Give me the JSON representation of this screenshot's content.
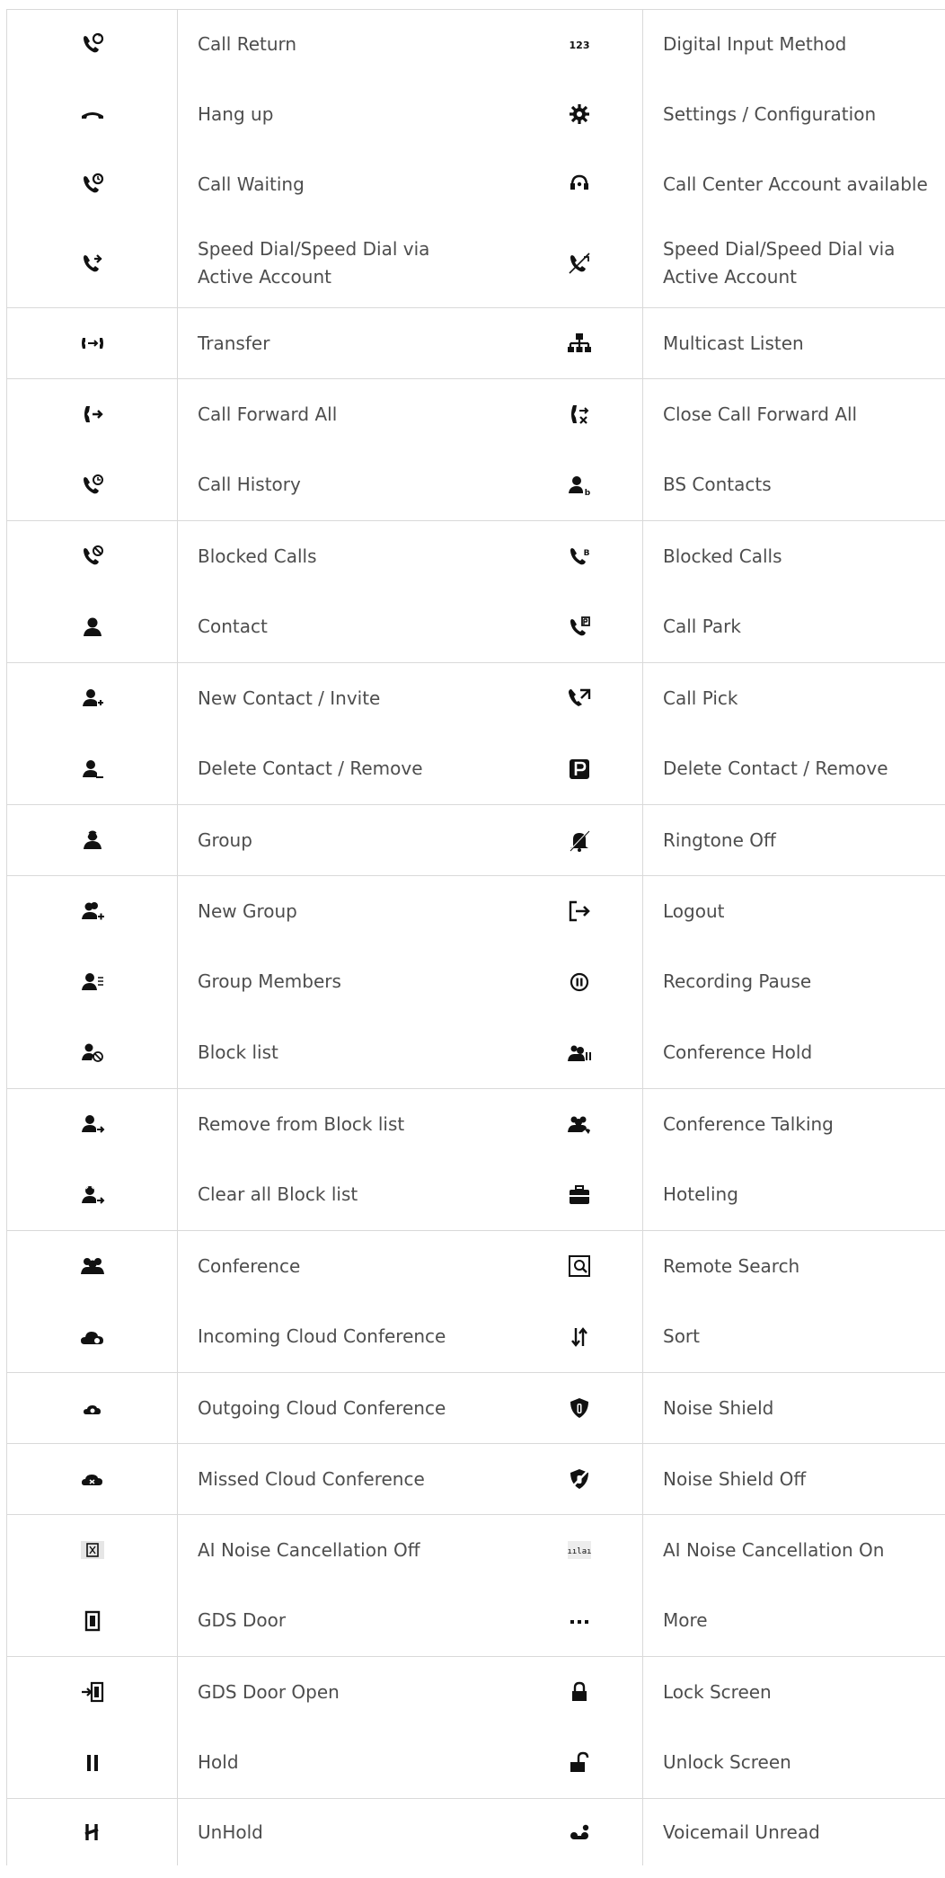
{
  "rows": [
    {
      "left_icon": "call-return-icon",
      "left_label": "Call Return",
      "right_icon": "digital-input-icon",
      "right_label": "Digital Input Method",
      "sep_after": false
    },
    {
      "left_icon": "hang-up-icon",
      "left_label": "Hang up",
      "right_icon": "settings-icon",
      "right_label": "Settings / Configuration",
      "sep_after": false
    },
    {
      "left_icon": "call-waiting-icon",
      "left_label": "Call Waiting",
      "right_icon": "call-center-icon",
      "right_label": "Call Center Account available",
      "sep_after": false
    },
    {
      "left_icon": "speed-dial-icon",
      "left_label": "Speed Dial/Speed Dial via\nActive Account",
      "right_icon": "speed-dial-alt-icon",
      "right_label": "Speed Dial/Speed Dial via\nActive Account",
      "sep_after": true
    },
    {
      "left_icon": "transfer-icon",
      "left_label": "Transfer",
      "right_icon": "multicast-listen-icon",
      "right_label": "Multicast Listen",
      "sep_after": true
    },
    {
      "left_icon": "call-forward-all-icon",
      "left_label": "Call Forward All",
      "right_icon": "close-call-forward-icon",
      "right_label": "Close Call Forward All",
      "sep_after": false
    },
    {
      "left_icon": "call-history-icon",
      "left_label": "Call History",
      "right_icon": "bs-contacts-icon",
      "right_label": "BS Contacts",
      "sep_after": true
    },
    {
      "left_icon": "blocked-calls-icon",
      "left_label": "Blocked Calls",
      "right_icon": "blocked-calls-alt-icon",
      "right_label": "Blocked Calls",
      "sep_after": false
    },
    {
      "left_icon": "contact-icon",
      "left_label": "Contact",
      "right_icon": "call-park-icon",
      "right_label": "Call Park",
      "sep_after": true
    },
    {
      "left_icon": "new-contact-icon",
      "left_label": "New Contact / Invite",
      "right_icon": "call-pick-icon",
      "right_label": "Call Pick",
      "sep_after": false
    },
    {
      "left_icon": "delete-contact-icon",
      "left_label": "Delete Contact / Remove",
      "right_icon": "delete-contact-p-icon",
      "right_label": "Delete Contact / Remove",
      "sep_after": true
    },
    {
      "left_icon": "group-icon",
      "left_label": "Group",
      "right_icon": "ringtone-off-icon",
      "right_label": "Ringtone Off",
      "sep_after": true
    },
    {
      "left_icon": "new-group-icon",
      "left_label": "New Group",
      "right_icon": "logout-icon",
      "right_label": "Logout",
      "sep_after": false
    },
    {
      "left_icon": "group-members-icon",
      "left_label": "Group Members",
      "right_icon": "recording-pause-icon",
      "right_label": "Recording Pause",
      "sep_after": false
    },
    {
      "left_icon": "block-list-icon",
      "left_label": "Block list",
      "right_icon": "conference-hold-icon",
      "right_label": "Conference Hold",
      "sep_after": true
    },
    {
      "left_icon": "remove-block-icon",
      "left_label": "Remove from Block list",
      "right_icon": "conference-talking-icon",
      "right_label": "Conference Talking",
      "sep_after": false
    },
    {
      "left_icon": "clear-block-icon",
      "left_label": "Clear all Block list",
      "right_icon": "hoteling-icon",
      "right_label": "Hoteling",
      "sep_after": true
    },
    {
      "left_icon": "conference-icon",
      "left_label": "Conference",
      "right_icon": "remote-search-icon",
      "right_label": "Remote Search",
      "sep_after": false
    },
    {
      "left_icon": "incoming-cloud-icon",
      "left_label": "Incoming Cloud Conference",
      "right_icon": "sort-icon",
      "right_label": "Sort",
      "sep_after": true
    },
    {
      "left_icon": "outgoing-cloud-icon",
      "left_label": "Outgoing Cloud Conference",
      "right_icon": "noise-shield-icon",
      "right_label": "Noise Shield",
      "sep_after": true
    },
    {
      "left_icon": "missed-cloud-icon",
      "left_label": "Missed Cloud Conference",
      "right_icon": "noise-shield-off-icon",
      "right_label": " Noise Shield Off",
      "sep_after": true
    },
    {
      "left_icon": "ai-noise-off-icon",
      "left_label": "AI Noise Cancellation Off",
      "right_icon": "ai-noise-on-icon",
      "right_label": "AI Noise Cancellation On",
      "sep_after": false
    },
    {
      "left_icon": "gds-door-icon",
      "left_label": "GDS Door",
      "right_icon": "more-icon",
      "right_label": "More",
      "sep_after": true
    },
    {
      "left_icon": "gds-door-open-icon",
      "left_label": "GDS Door Open",
      "right_icon": "lock-screen-icon",
      "right_label": "Lock Screen",
      "sep_after": false
    },
    {
      "left_icon": "hold-icon",
      "left_label": "Hold",
      "right_icon": "unlock-screen-icon",
      "right_label": "Unlock Screen",
      "sep_after": true
    },
    {
      "left_icon": "unhold-icon",
      "left_label": "UnHold",
      "right_icon": "voicemail-unread-icon",
      "right_label": "Voicemail Unread",
      "sep_after": false
    }
  ]
}
